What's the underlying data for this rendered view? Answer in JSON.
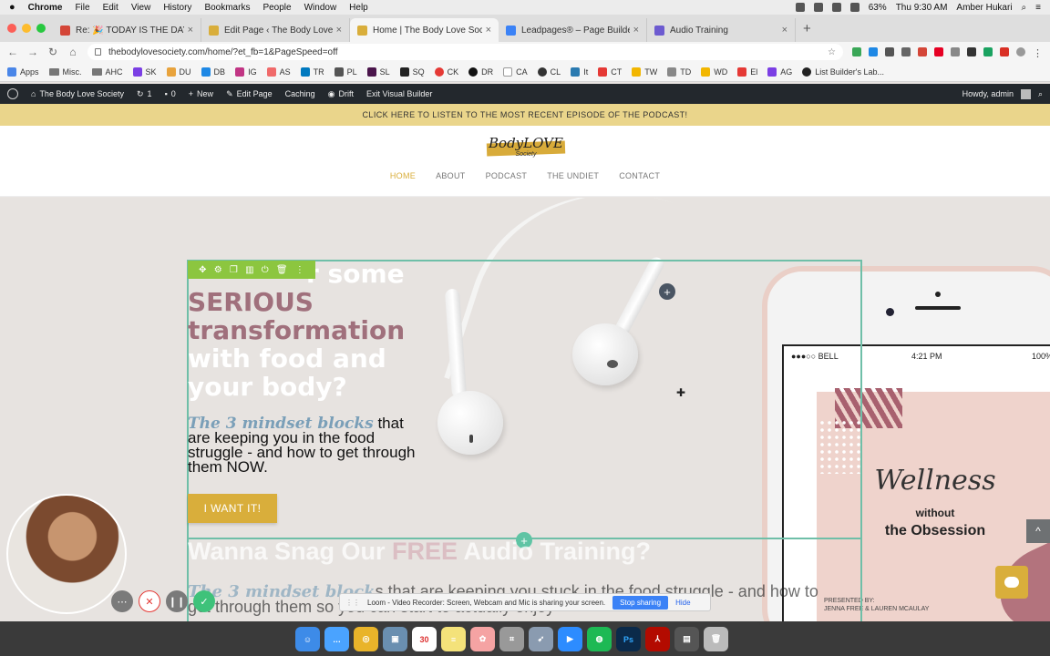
{
  "menubar": {
    "items": [
      "Chrome",
      "File",
      "Edit",
      "View",
      "History",
      "Bookmarks",
      "People",
      "Window",
      "Help"
    ],
    "battery": "63%",
    "datetime": "Thu 9:30 AM",
    "user": "Amber Hukari"
  },
  "tabs": [
    {
      "title": "Re: 🎉 TODAY IS THE DAY!!!!!!",
      "color": "#d44638"
    },
    {
      "title": "Edit Page ‹ The Body Love Soc",
      "color": "#d9ae3b"
    },
    {
      "title": "Home | The Body Love Society",
      "color": "#d9ae3b",
      "active": true
    },
    {
      "title": "Leadpages® – Page Builder",
      "color": "#3b82f6"
    },
    {
      "title": "Audio Training",
      "color": "#6d5bd0"
    }
  ],
  "address": {
    "url": "thebodylovesociety.com/home/?et_fb=1&PageSpeed=off"
  },
  "bookmarks": [
    "Apps",
    "Misc.",
    "AHC",
    "SK",
    "DU",
    "DB",
    "IG",
    "AS",
    "TR",
    "PL",
    "SL",
    "SQ",
    "CK",
    "DR",
    "CA",
    "CL",
    "It",
    "CT",
    "TW",
    "TD",
    "WD",
    "El",
    "AG",
    "List Builder's Lab..."
  ],
  "wpbar": {
    "site": "The Body Love Society",
    "updates": "1",
    "comments": "0",
    "new": "New",
    "edit_page": "Edit Page",
    "caching": "Caching",
    "drift": "Drift",
    "exit": "Exit Visual Builder",
    "howdy": "Howdy, admin"
  },
  "banner": {
    "text": "CLICK HERE TO LISTEN TO THE MOST RECENT EPISODE OF THE PODCAST!"
  },
  "logo": {
    "text": "BodyLOVE",
    "sub": "Society"
  },
  "nav": [
    "HOME",
    "ABOUT",
    "PODCAST",
    "THE UNDIET",
    "CONTACT"
  ],
  "hero": {
    "headline_l1": "r some",
    "headline_l2": "SERIOUS",
    "headline_l3": "transformation",
    "headline_l4": "with food and",
    "headline_l5": "your body?",
    "sub_em": "The 3 mindset blocks",
    "sub_rest": " that are keeping you in the food struggle - and how to get through them NOW.",
    "cta": "I WANT IT!"
  },
  "section2": {
    "headline_a": "Wanna Snag Our ",
    "headline_b": "FREE",
    "headline_c": " Audio Training?",
    "sub_em": "The 3 mindset block",
    "sub_rest": "s that are keeping you stuck in the food struggle - and how to get through them so you can start to actually enjoy"
  },
  "phone": {
    "carrier": "●●●○○ BELL",
    "time": "4:21 PM",
    "battery": "100%",
    "title_script": "Wellness",
    "title_without": "without",
    "title_obsession": "the Obsession",
    "presented": "PRESENTED BY:",
    "authors": "JENNA FREE & LAUREN MCAULAY"
  },
  "loom": {
    "message": "Loom - Video Recorder: Screen, Webcam and Mic is sharing your screen.",
    "stop": "Stop sharing",
    "hide": "Hide"
  },
  "dock": [
    "Finder",
    "Msg",
    "Chrome",
    "Preview",
    "Cal",
    "Notes",
    "Photos",
    "Screenshot",
    "Launch",
    "Zoom",
    "Spotify",
    "Ps",
    "Acrobat",
    "Files",
    "Trash"
  ],
  "dock_date": "30"
}
